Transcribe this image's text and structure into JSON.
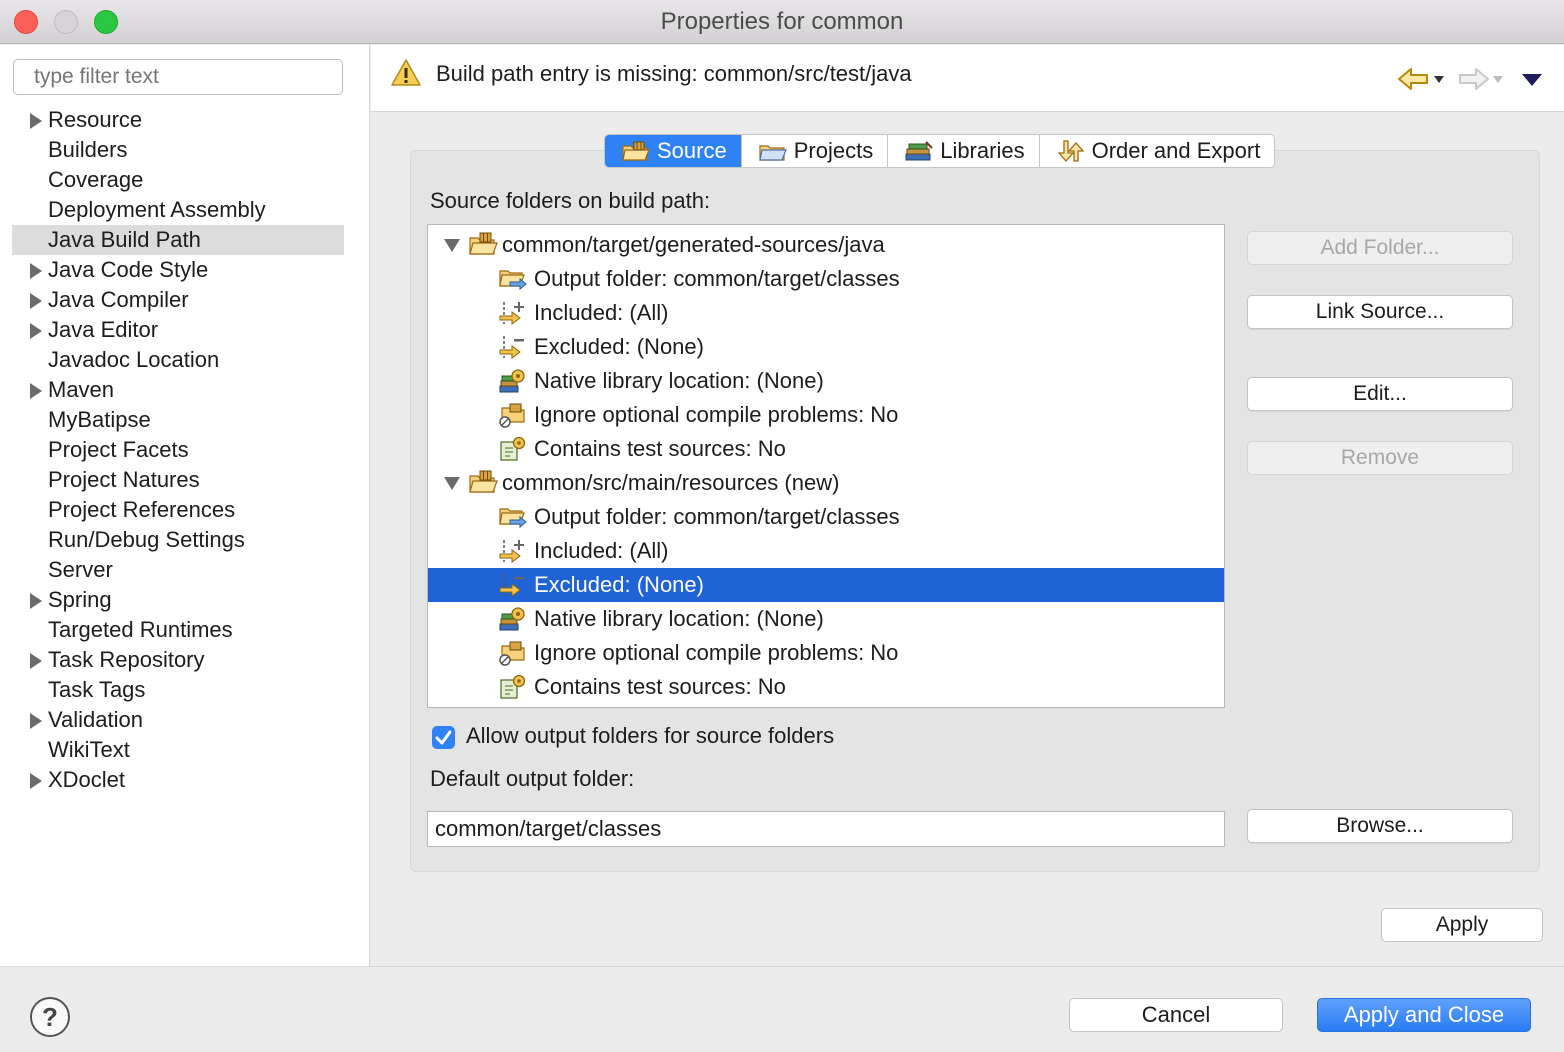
{
  "window": {
    "title": "Properties for common"
  },
  "sidebar": {
    "filter_placeholder": "type filter text",
    "items": [
      {
        "label": "Resource",
        "expandable": true
      },
      {
        "label": "Builders",
        "expandable": false
      },
      {
        "label": "Coverage",
        "expandable": false
      },
      {
        "label": "Deployment Assembly",
        "expandable": false
      },
      {
        "label": "Java Build Path",
        "expandable": false,
        "selected": true
      },
      {
        "label": "Java Code Style",
        "expandable": true
      },
      {
        "label": "Java Compiler",
        "expandable": true
      },
      {
        "label": "Java Editor",
        "expandable": true
      },
      {
        "label": "Javadoc Location",
        "expandable": false
      },
      {
        "label": "Maven",
        "expandable": true
      },
      {
        "label": "MyBatipse",
        "expandable": false
      },
      {
        "label": "Project Facets",
        "expandable": false
      },
      {
        "label": "Project Natures",
        "expandable": false
      },
      {
        "label": "Project References",
        "expandable": false
      },
      {
        "label": "Run/Debug Settings",
        "expandable": false
      },
      {
        "label": "Server",
        "expandable": false
      },
      {
        "label": "Spring",
        "expandable": true
      },
      {
        "label": "Targeted Runtimes",
        "expandable": false
      },
      {
        "label": "Task Repository",
        "expandable": true
      },
      {
        "label": "Task Tags",
        "expandable": false
      },
      {
        "label": "Validation",
        "expandable": true
      },
      {
        "label": "WikiText",
        "expandable": false
      },
      {
        "label": "XDoclet",
        "expandable": true
      }
    ]
  },
  "header": {
    "message": "Build path entry is missing: common/src/test/java",
    "icons": [
      "warning-icon",
      "back-arrow-icon",
      "forward-arrow-icon",
      "view-menu-icon"
    ]
  },
  "tabs": [
    {
      "label": "Source",
      "active": true,
      "icon": "source-folder-icon"
    },
    {
      "label": "Projects",
      "active": false,
      "icon": "projects-icon"
    },
    {
      "label": "Libraries",
      "active": false,
      "icon": "libraries-icon"
    },
    {
      "label": "Order and Export",
      "active": false,
      "icon": "order-export-icon"
    }
  ],
  "source": {
    "label": "Source folders on build path:",
    "tree": [
      {
        "label": "common/target/generated-sources/java",
        "expanded": true,
        "children": [
          {
            "label": "Output folder: common/target/classes",
            "icon": "output-folder-icon"
          },
          {
            "label": "Included: (All)",
            "icon": "included-icon"
          },
          {
            "label": "Excluded: (None)",
            "icon": "excluded-icon"
          },
          {
            "label": "Native library location: (None)",
            "icon": "native-library-icon"
          },
          {
            "label": "Ignore optional compile problems: No",
            "icon": "ignore-problems-icon"
          },
          {
            "label": "Contains test sources: No",
            "icon": "test-sources-icon"
          }
        ]
      },
      {
        "label": "common/src/main/resources (new)",
        "expanded": true,
        "children": [
          {
            "label": "Output folder: common/target/classes",
            "icon": "output-folder-icon"
          },
          {
            "label": "Included: (All)",
            "icon": "included-icon"
          },
          {
            "label": "Excluded: (None)",
            "icon": "excluded-icon",
            "selected": true
          },
          {
            "label": "Native library location: (None)",
            "icon": "native-library-icon"
          },
          {
            "label": "Ignore optional compile problems: No",
            "icon": "ignore-problems-icon"
          },
          {
            "label": "Contains test sources: No",
            "icon": "test-sources-icon"
          }
        ]
      }
    ],
    "buttons": {
      "add_folder": "Add Folder...",
      "link_source": "Link Source...",
      "edit": "Edit...",
      "remove": "Remove",
      "browse": "Browse..."
    },
    "allow_output_label": "Allow output folders for source folders",
    "allow_output_checked": true,
    "default_output_label": "Default output folder:",
    "default_output_value": "common/target/classes"
  },
  "footer": {
    "apply": "Apply",
    "cancel": "Cancel",
    "apply_and_close": "Apply and Close",
    "help": "?"
  },
  "colors": {
    "accent": "#2f82f6",
    "selection": "#1f63d6",
    "warning": "#f3c33f"
  }
}
